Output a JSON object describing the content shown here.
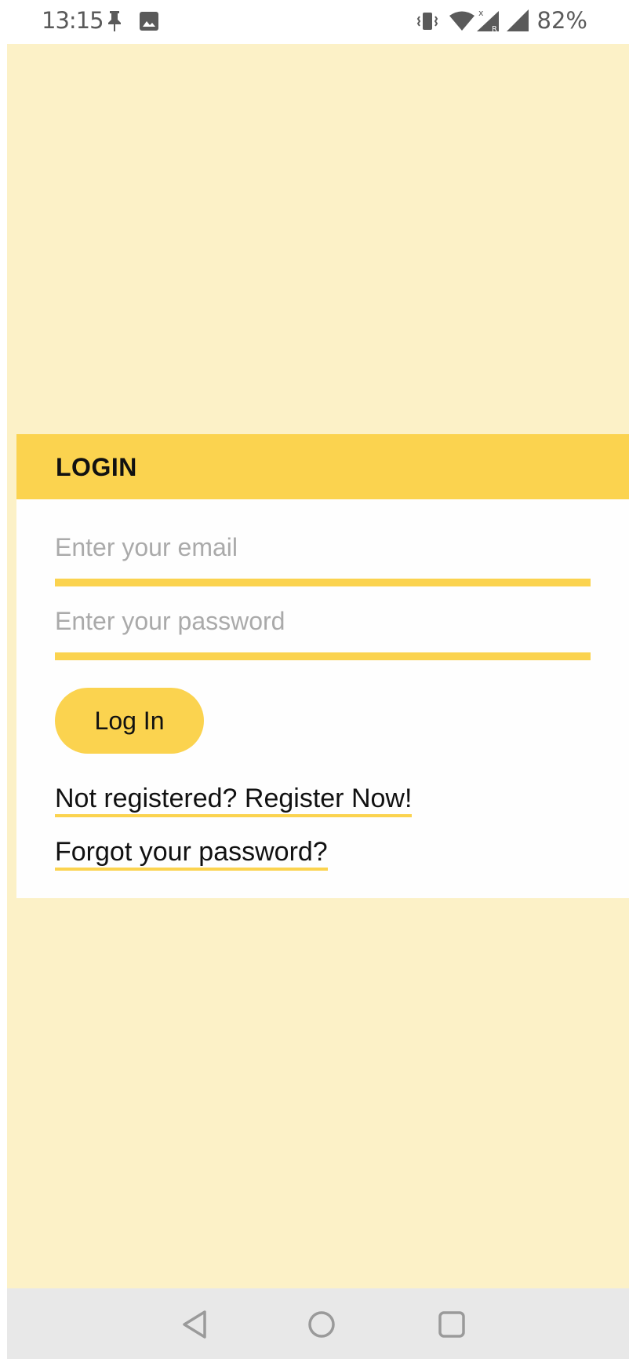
{
  "status_bar": {
    "time": "13:15",
    "battery": "82%",
    "icons": [
      "pin-icon",
      "image-icon",
      "vibrate-icon",
      "wifi-icon",
      "signal-roaming-icon",
      "signal-icon"
    ]
  },
  "login": {
    "title": "LOGIN",
    "email_placeholder": "Enter your email",
    "email_value": "",
    "password_placeholder": "Enter your password",
    "password_value": "",
    "submit_label": "Log In",
    "register_link": "Not registered? Register Now!",
    "forgot_link": "Forgot your password?"
  },
  "nav": {
    "back": "back-icon",
    "home": "home-icon",
    "recents": "recents-icon"
  },
  "colors": {
    "accent": "#fbd34f",
    "background": "#fcf1c7",
    "card": "#fefefe"
  }
}
